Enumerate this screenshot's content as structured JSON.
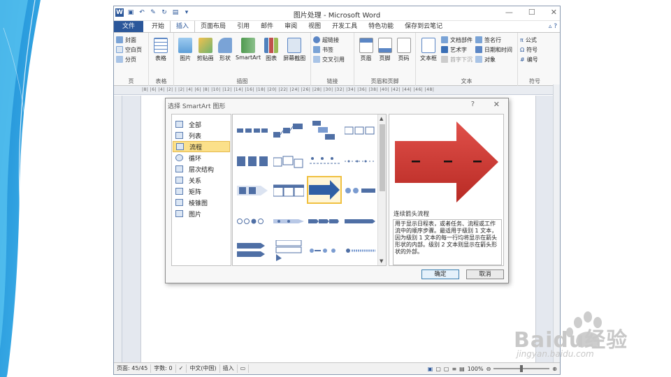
{
  "app": {
    "title": "图片处理 - Microsoft Word",
    "win_min": "—",
    "win_max": "☐",
    "win_close": "✕"
  },
  "tabs": [
    {
      "label": "文件"
    },
    {
      "label": "开始"
    },
    {
      "label": "插入"
    },
    {
      "label": "页面布局"
    },
    {
      "label": "引用"
    },
    {
      "label": "邮件"
    },
    {
      "label": "审阅"
    },
    {
      "label": "视图"
    },
    {
      "label": "开发工具"
    },
    {
      "label": "特色功能"
    },
    {
      "label": "保存到云笔记"
    }
  ],
  "active_tab": "插入",
  "ribbon": {
    "pages": {
      "cover": "封面",
      "blank": "空白页",
      "break": "分页",
      "group": "页"
    },
    "tables": {
      "table": "表格",
      "group": "表格"
    },
    "illustrations": {
      "picture": "图片",
      "clipart": "剪贴画",
      "shapes": "形状",
      "smartart": "SmartArt",
      "chart": "图表",
      "screenshot": "屏幕截图",
      "group": "插图"
    },
    "links": {
      "hyperlink": "超链接",
      "bookmark": "书签",
      "crossref": "交叉引用",
      "group": "链接"
    },
    "header_footer": {
      "header": "页眉",
      "footer": "页脚",
      "pagenum": "页码",
      "group": "页眉和页脚"
    },
    "text": {
      "textbox": "文本框",
      "docparts": "文档部件",
      "wordart": "艺术字",
      "dropcap": "首字下沉",
      "signature": "签名行",
      "datetime": "日期和时间",
      "object": "对象",
      "group": "文本"
    },
    "symbols": {
      "equation": "公式",
      "symbol": "符号",
      "number": "编号",
      "group": "符号"
    }
  },
  "ruler_text": "|8| |6| |4| |2| | |2| |4| |6| |8| |10| |12| |14| |16| |18| |20| |22| |24| |26| |28| |30| |32| |34| |36| |38| |40| |42| |44| |46| |48|",
  "dialog": {
    "title": "选择 SmartArt 图形",
    "help": "?",
    "close": "✕",
    "categories": [
      {
        "label": "全部"
      },
      {
        "label": "列表"
      },
      {
        "label": "流程"
      },
      {
        "label": "循环"
      },
      {
        "label": "层次结构"
      },
      {
        "label": "关系"
      },
      {
        "label": "矩阵"
      },
      {
        "label": "棱锥图"
      },
      {
        "label": "图片"
      }
    ],
    "selected_category": "流程",
    "preview_name": "连续箭头流程",
    "preview_desc": "用于显示日程表，或者任务、流程或工作流中的顺序步骤。最适用于级别 1 文本，因为级别 1 文本的每一行均将显示在箭头形状的内部。级别 2 文本则显示在箭头形状的外部。",
    "ok": "确定",
    "cancel": "取消"
  },
  "status": {
    "page": "页面: 45/45",
    "words": "字数: 0",
    "lang": "中文(中国)",
    "mode": "插入",
    "zoom": "100%"
  },
  "watermark": {
    "brand": "Baidu经验",
    "url": "jingyan.baidu.com"
  },
  "colors": {
    "accent": "#2b579a",
    "arrow": "#d23a32",
    "selection": "#fbe08a"
  }
}
